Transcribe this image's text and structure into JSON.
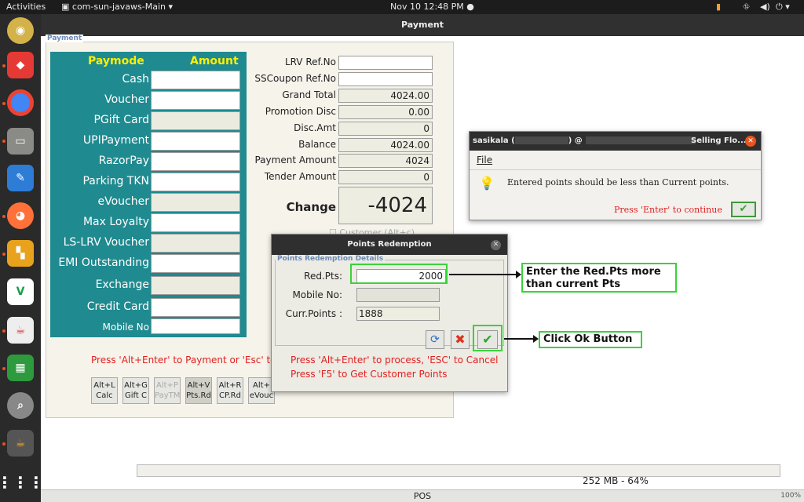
{
  "topbar": {
    "activities": "Activities",
    "app_menu": "com-sun-javaws-Main",
    "clock": "Nov 10  12:48 PM"
  },
  "window": {
    "title": "Payment",
    "status": "POS",
    "memory": "252 MB - 64%",
    "zoom": "100%"
  },
  "payment": {
    "group_label": "Payment",
    "paymode_header": "Paymode",
    "amount_header": "Amount",
    "modes": [
      {
        "label": "Cash",
        "disabled": false
      },
      {
        "label": "Voucher",
        "disabled": false
      },
      {
        "label": "PGift Card",
        "disabled": true
      },
      {
        "label": "UPIPayment",
        "disabled": false
      },
      {
        "label": "RazorPay",
        "disabled": false
      },
      {
        "label": "Parking TKN",
        "disabled": false
      },
      {
        "label": "eVoucher",
        "disabled": true
      },
      {
        "label": "Max Loyalty",
        "disabled": false
      },
      {
        "label": "LS-LRV Voucher",
        "disabled": true
      },
      {
        "label": "EMI Outstanding",
        "disabled": false
      },
      {
        "label": "Exchange",
        "disabled": true
      },
      {
        "label": "Credit Card",
        "disabled": false
      },
      {
        "label": "Mobile No",
        "disabled": false
      }
    ]
  },
  "summary": {
    "lrv_label": "LRV Ref.No",
    "lrv_value": "",
    "sscoupon_label": "SSCoupon Ref.No",
    "sscoupon_value": "",
    "grand_total_label": "Grand Total",
    "grand_total": "4024.00",
    "promo_label": "Promotion Disc",
    "promo": "0.00",
    "disc_label": "Disc.Amt",
    "disc": "0",
    "balance_label": "Balance",
    "balance": "4024.00",
    "payamt_label": "Payment Amount",
    "payamt": "4024",
    "tender_label": "Tender Amount",
    "tender": "0",
    "change_label": "Change",
    "change": "-4024",
    "customer_checkbox": "Customer (Alt+c)"
  },
  "hint": "Press 'Alt+Enter' to Payment or 'Esc' to",
  "shortcuts": [
    {
      "l1": "Alt+L",
      "l2": "Calc",
      "state": "normal"
    },
    {
      "l1": "Alt+G",
      "l2": "Gift C",
      "state": "normal"
    },
    {
      "l1": "Alt+P",
      "l2": "PayTM",
      "state": "dim"
    },
    {
      "l1": "Alt+V",
      "l2": "Pts.Rd",
      "state": "selected"
    },
    {
      "l1": "Alt+R",
      "l2": "CP.Rd",
      "state": "normal"
    },
    {
      "l1": "Alt+",
      "l2": "eVouc",
      "state": "normal"
    }
  ],
  "redemption": {
    "title": "Points Redemption",
    "group": "Points Redemption Details",
    "red_pts_label": "Red.Pts:",
    "red_pts": "2000",
    "mobile_label": "Mobile No:",
    "mobile": "",
    "curr_label": "Curr.Points :",
    "curr": "1888",
    "hint1": "Press 'Alt+Enter' to process, 'ESC' to Cancel",
    "hint2": "Press 'F5' to Get Customer Points"
  },
  "message": {
    "title_user": "sasikala (",
    "title_mid": ") @",
    "title_end": "Selling Flo...",
    "menu_file": "File",
    "text": "Entered points should be less than Current points.",
    "continue": "Press 'Enter' to continue"
  },
  "annotations": {
    "red_pts_note": "Enter the Red.Pts more than current Pts",
    "ok_note": "Click Ok Button"
  },
  "colors": {
    "paypanel": "#1f8a8f",
    "paymode_header": "#ffee00",
    "error_red": "#e02020",
    "annotation_border": "#3bd23b"
  }
}
